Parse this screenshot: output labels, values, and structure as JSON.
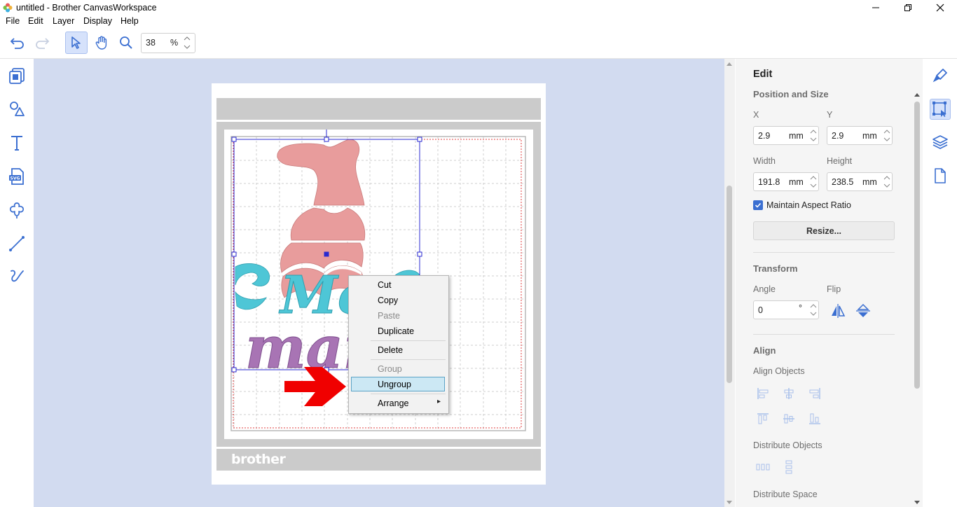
{
  "window": {
    "title": "untitled - Brother CanvasWorkspace",
    "minimize_glyph": "—",
    "maximize_glyph": "❐",
    "close_glyph": "✕"
  },
  "menu": [
    "File",
    "Edit",
    "Layer",
    "Display",
    "Help"
  ],
  "toolbar": {
    "tools": [
      "undo-icon",
      "redo-icon",
      "select-arrow-icon",
      "hand-pan-icon",
      "zoom-magnifier-icon"
    ],
    "zoom_value": "38",
    "zoom_unit": "%"
  },
  "left_tools": [
    "import-image-icon",
    "shapes-icon",
    "text-icon",
    "svg-import-icon",
    "pattern-library-icon",
    "line-icon",
    "freehand-draw-icon"
  ],
  "mat": {
    "brand": "brother",
    "design_words": [
      "Mer",
      "man"
    ]
  },
  "context_menu": {
    "items": [
      {
        "label": "Cut",
        "enabled": true
      },
      {
        "label": "Copy",
        "enabled": true
      },
      {
        "label": "Paste",
        "enabled": false
      },
      {
        "label": "Duplicate",
        "enabled": true
      },
      {
        "label": "Delete",
        "enabled": true
      },
      {
        "label": "Group",
        "enabled": false
      },
      {
        "label": "Ungroup",
        "enabled": true,
        "highlighted": true
      },
      {
        "label": "Arrange",
        "enabled": true,
        "submenu": true
      }
    ],
    "submenu_glyph": "▸"
  },
  "panel": {
    "title": "Edit",
    "position_size": {
      "heading": "Position and Size",
      "x_label": "X",
      "x_value": "2.9",
      "x_unit": "mm",
      "y_label": "Y",
      "y_value": "2.9",
      "y_unit": "mm",
      "width_label": "Width",
      "width_value": "191.8",
      "width_unit": "mm",
      "height_label": "Height",
      "height_value": "238.5",
      "height_unit": "mm",
      "maintain_aspect_label": "Maintain Aspect Ratio",
      "maintain_aspect_checked": true,
      "resize_button": "Resize..."
    },
    "transform": {
      "heading": "Transform",
      "angle_label": "Angle",
      "angle_value": "0",
      "angle_unit": "°",
      "flip_label": "Flip"
    },
    "align": {
      "heading": "Align",
      "align_objects_label": "Align Objects",
      "distribute_objects_label": "Distribute Objects",
      "distribute_space_label": "Distribute Space"
    }
  },
  "right_tools": [
    "paint-brush-icon",
    "transform-select-icon",
    "layers-icon",
    "page-icon"
  ],
  "colors": {
    "canvas_bg": "#d2dbf0",
    "accent": "#3b6fd1",
    "selection": "#2a2ad0",
    "tail_pink": "#e89c9c",
    "text_teal": "#4ec6d6",
    "text_purple": "#a874b4",
    "arrow_red": "#f00000"
  }
}
